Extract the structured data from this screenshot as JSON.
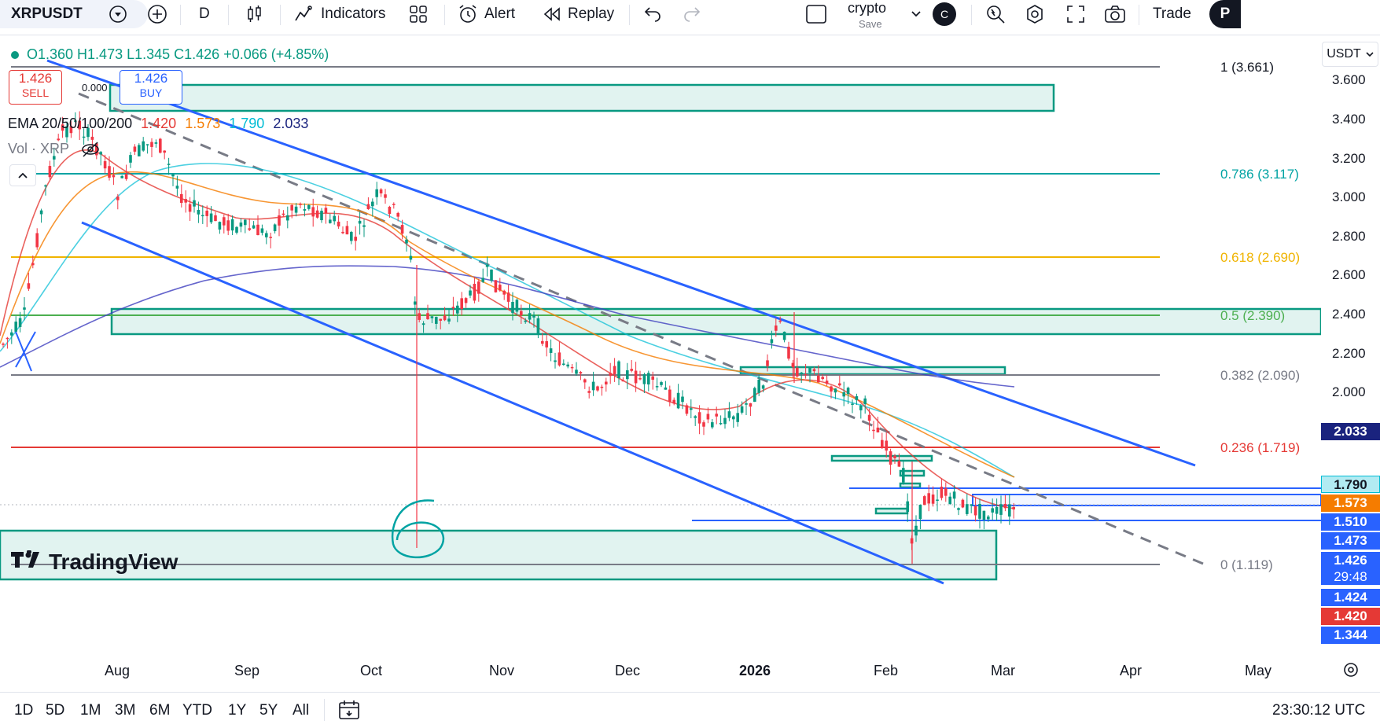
{
  "toolbar": {
    "symbol": "XRPUSDT",
    "interval": "D",
    "indicators_label": "Indicators",
    "alert_label": "Alert",
    "replay_label": "Replay",
    "layout_name": "crypto",
    "layout_save": "Save",
    "avatar_letter": "C",
    "trade_label": "Trade",
    "publish_initial": "P"
  },
  "legend": {
    "ohlc": "O1.360 H1.473 L1.345 C1.426 +0.066 (+4.85%)",
    "sell_price": "1.426",
    "sell_label": "SELL",
    "spread": "0.000",
    "buy_price": "1.426",
    "buy_label": "BUY",
    "ema_label": "EMA 20/50/100/200",
    "ema20": "1.420",
    "ema50": "1.573",
    "ema100": "1.790",
    "ema200": "2.033",
    "vol_label": "Vol · XRP"
  },
  "fib": [
    {
      "label": "1 (3.661)",
      "color": "#787b86"
    },
    {
      "label": "0.786 (3.117)",
      "color": "#00a3a3"
    },
    {
      "label": "0.618 (2.690)",
      "color": "#f0b400"
    },
    {
      "label": "0.5 (2.390)",
      "color": "#4caf50"
    },
    {
      "label": "0.382 (2.090)",
      "color": "#787b86"
    },
    {
      "label": "0.236 (1.719)",
      "color": "#e53935"
    },
    {
      "label": "0 (1.119)",
      "color": "#787b86"
    }
  ],
  "price_scale": {
    "currency": "USDT",
    "ticks": [
      "3.600",
      "3.400",
      "3.200",
      "3.000",
      "2.800",
      "2.600",
      "2.400",
      "2.200",
      "2.000"
    ],
    "tags": [
      {
        "text": "2.033",
        "color": "#1a237e"
      },
      {
        "text": "1.790",
        "color": "#00bcd4"
      },
      {
        "text": "1.573",
        "color": "#f57c00"
      },
      {
        "text": "1.510",
        "color": "#2962ff"
      },
      {
        "text": "1.473",
        "color": "#2962ff"
      },
      {
        "text": "1.426",
        "color": "#2962ff"
      },
      {
        "text": "29:48",
        "color": "#2962ff"
      },
      {
        "text": "1.424",
        "color": "#2962ff"
      },
      {
        "text": "1.420",
        "color": "#e53935"
      },
      {
        "text": "1.344",
        "color": "#2962ff"
      }
    ]
  },
  "time_axis": [
    "Aug",
    "Sep",
    "Oct",
    "Nov",
    "Dec",
    "2026",
    "Feb",
    "Mar",
    "Apr",
    "May"
  ],
  "ranges": [
    "1D",
    "5D",
    "1M",
    "3M",
    "6M",
    "YTD",
    "1Y",
    "5Y",
    "All"
  ],
  "clock": "23:30:12 UTC",
  "watermark": "TradingView",
  "colors": {
    "up": "#089981",
    "down": "#f23645",
    "channel": "#2962ff",
    "zone": "#089981"
  }
}
